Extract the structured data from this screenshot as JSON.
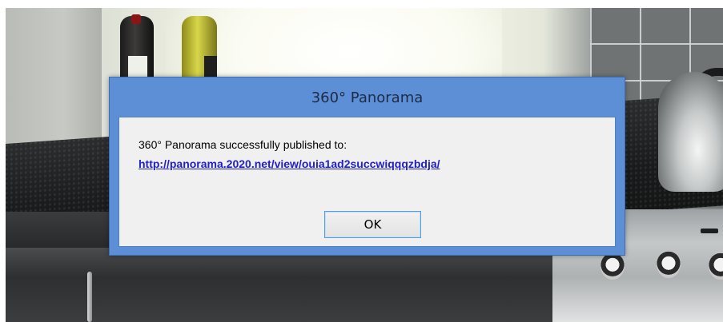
{
  "dialog": {
    "title": "360° Panorama",
    "message": "360° Panorama successfully published to:",
    "link_text": "http://panorama.2020.net/view/ouia1ad2succwiqqqzbdja/",
    "ok_label": "OK"
  },
  "colors": {
    "titlebar": "#5d8fd6",
    "client_background": "#f0f0f0",
    "link": "#2020c8"
  }
}
